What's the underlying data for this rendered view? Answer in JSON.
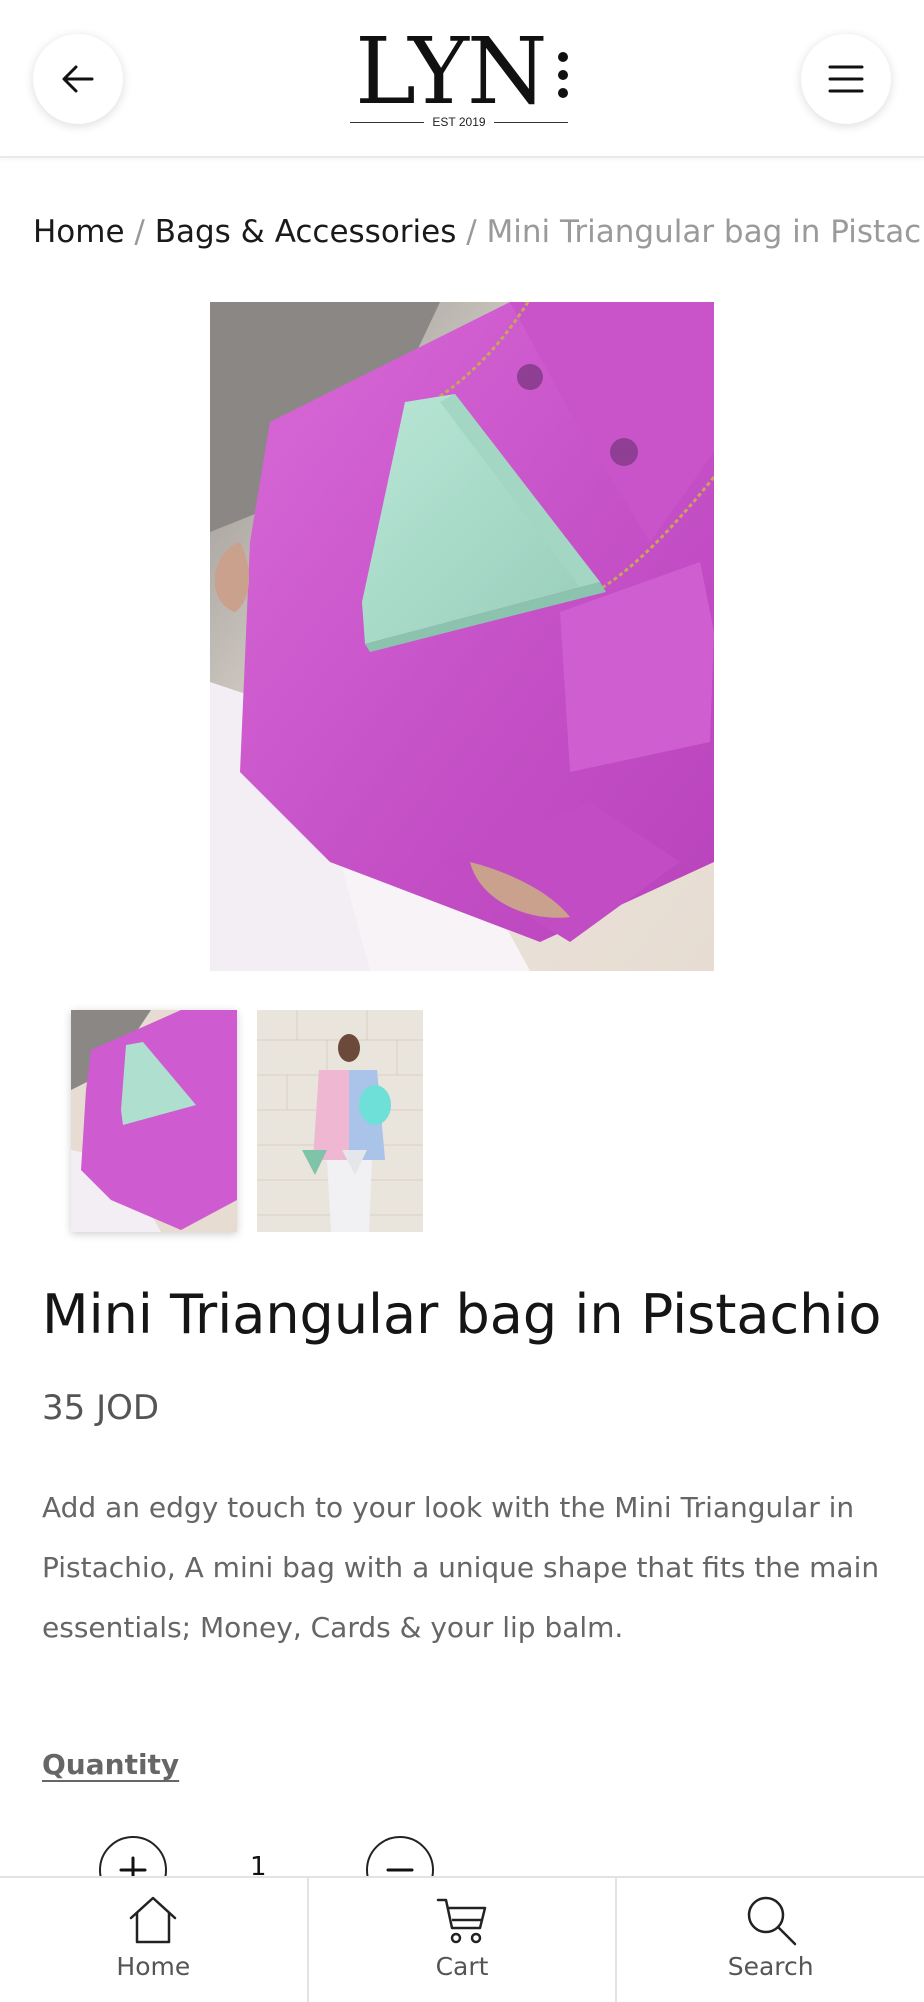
{
  "header": {
    "logo_text": "LYN",
    "logo_subtext": "EST 2019",
    "back_icon": "arrow-left-icon",
    "menu_icon": "hamburger-menu-icon"
  },
  "breadcrumb": {
    "home": "Home",
    "separator": "/",
    "category": "Bags & Accessories",
    "current": "Mini Triangular bag in Pistachio"
  },
  "product": {
    "title": "Mini Triangular bag in Pistachio",
    "price": "35 JOD",
    "description": "Add an edgy touch to your look with the Mini Triangular in Pistachio, A mini bag with a unique shape that fits the main essentials; Money, Cards & your lip balm."
  },
  "quantity": {
    "label": "Quantity",
    "value": "1",
    "plus_icon": "plus-icon",
    "minus_icon": "minus-icon"
  },
  "bottom_nav": {
    "items": [
      {
        "label": "Home",
        "icon": "home-icon"
      },
      {
        "label": "Cart",
        "icon": "cart-icon"
      },
      {
        "label": "Search",
        "icon": "search-icon"
      }
    ]
  },
  "colors": {
    "accent_text": "#1a1a1a",
    "muted_text": "#666666",
    "breadcrumb_current": "#9a9a9a",
    "bag_pistachio": "#a9dccb",
    "blazer_pink": "#d35bd3"
  }
}
